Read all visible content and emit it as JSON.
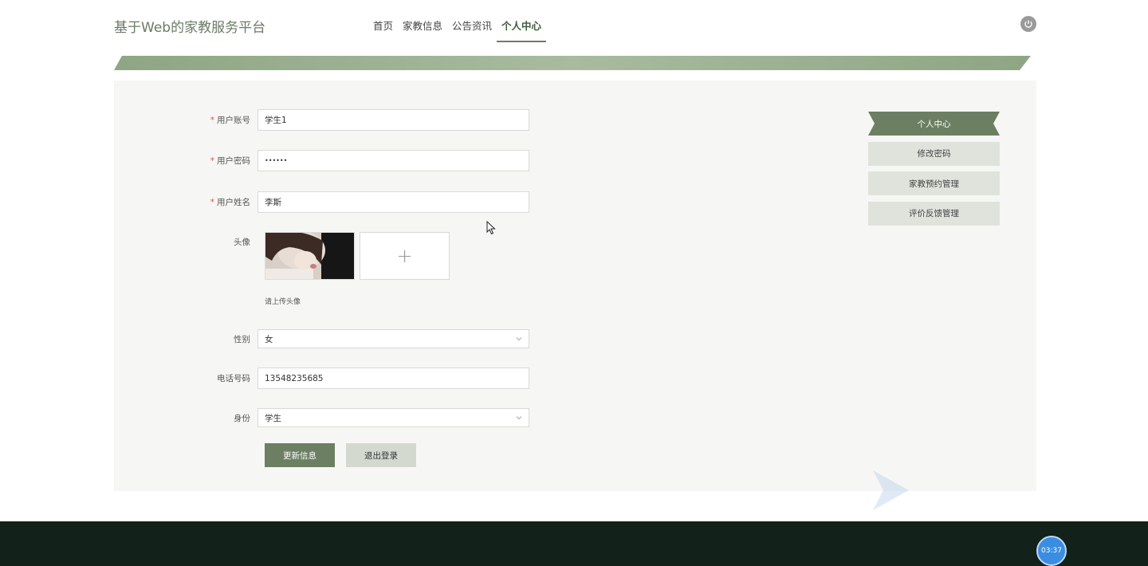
{
  "header": {
    "site_title": "基于Web的家教服务平台",
    "nav": [
      {
        "label": "首页"
      },
      {
        "label": "家教信息"
      },
      {
        "label": "公告资讯"
      },
      {
        "label": "个人中心"
      }
    ]
  },
  "form": {
    "account": {
      "label": "用户账号",
      "value": "学生1"
    },
    "password": {
      "label": "用户密码",
      "value": "••••••"
    },
    "name": {
      "label": "用户姓名",
      "value": "李斯"
    },
    "avatar": {
      "label": "头像",
      "hint": "请上传头像",
      "add_symbol": "+"
    },
    "gender": {
      "label": "性别",
      "value": "女"
    },
    "phone": {
      "label": "电话号码",
      "value": "13548235685"
    },
    "role": {
      "label": "身份",
      "value": "学生"
    },
    "required_mark": "*",
    "update_button": "更新信息",
    "logout_button": "退出登录"
  },
  "side_menu": {
    "items": [
      {
        "label": "个人中心"
      },
      {
        "label": "修改密码"
      },
      {
        "label": "家教预约管理"
      },
      {
        "label": "评价反馈管理"
      }
    ]
  },
  "overlay": {
    "timer": "03:37"
  },
  "colors": {
    "accent": "#6c7f62",
    "footer": "#122119",
    "panel_bg": "#f6f7f5"
  }
}
